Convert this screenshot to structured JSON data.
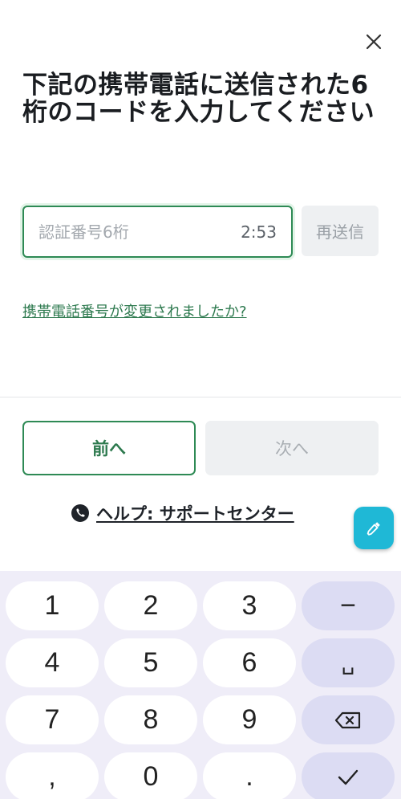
{
  "title": "下記の携帯電話に送信された6桁のコードを入力してください",
  "close_icon": "close-icon",
  "code_field": {
    "placeholder": "認証番号6桁",
    "value": "",
    "timer": "2:53"
  },
  "resend_label": "再送信",
  "change_phone_link": "携帯電話番号が変更されましたか?",
  "buttons": {
    "prev_label": "前へ",
    "next_label": "次へ"
  },
  "help": {
    "icon": "phone-icon",
    "label": "ヘルプ: サポートセンター"
  },
  "fab_icon": "eyedropper-icon",
  "keyboard": {
    "keys": {
      "k1": "1",
      "k2": "2",
      "k3": "3",
      "minus": "−",
      "k4": "4",
      "k5": "5",
      "k6": "6",
      "space": "␣",
      "k7": "7",
      "k8": "8",
      "k9": "9",
      "comma": ",",
      "k0": "0",
      "period": "."
    },
    "backspace_icon": "backspace-icon",
    "done_icon": "checkmark-icon"
  },
  "colors": {
    "accent_green": "#2e8a55",
    "link_green": "#2e7a4f",
    "fab_cyan": "#1fb8d6",
    "keyboard_bg": "#efedf8",
    "func_key": "#dcdcf3"
  }
}
